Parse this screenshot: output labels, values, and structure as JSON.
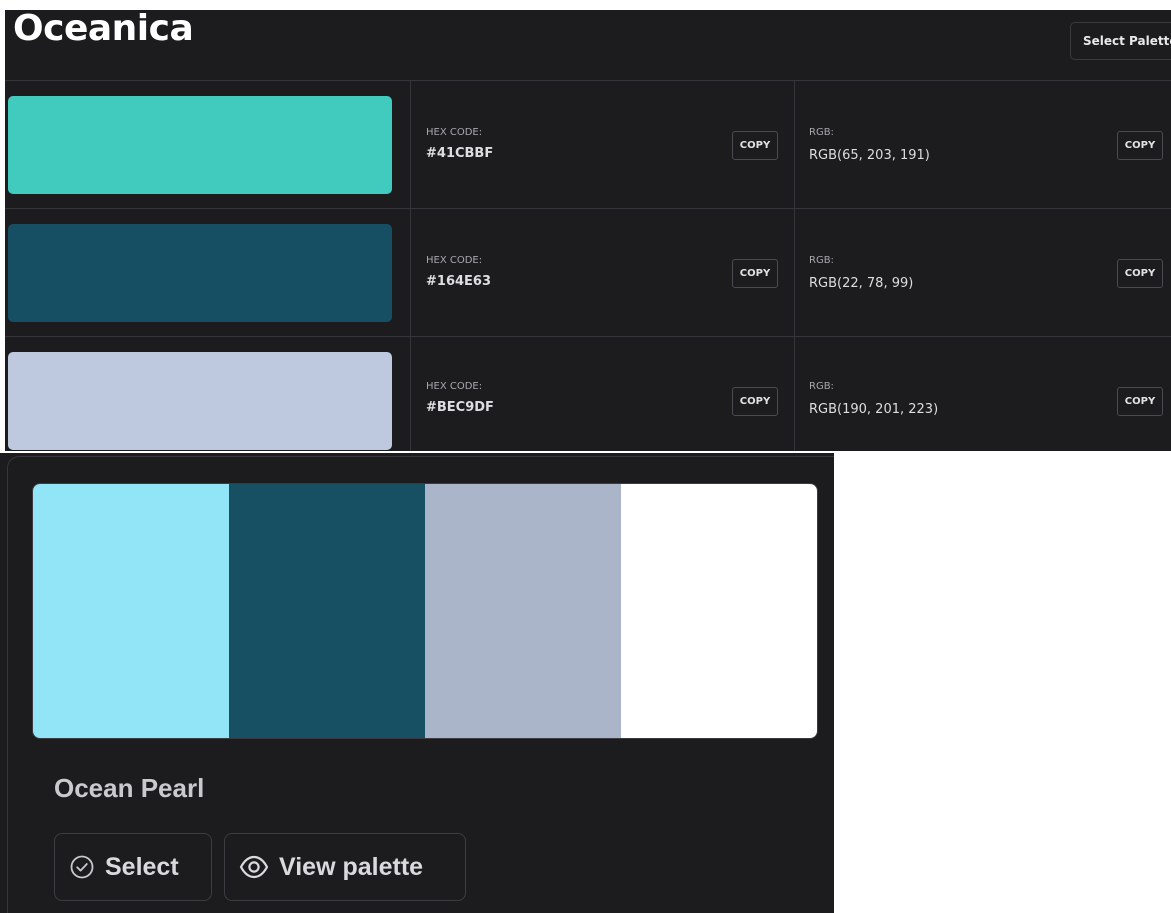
{
  "header": {
    "title": "Oceanica",
    "select_palette_label": "Select Palette"
  },
  "colors": [
    {
      "swatch": "#41CBBF",
      "hex_label": "HEX CODE:",
      "hex": "#41CBBF",
      "rgb_label": "RGB:",
      "rgb": "RGB(65, 203, 191)",
      "copy_label": "COPY"
    },
    {
      "swatch": "#164E63",
      "hex_label": "HEX CODE:",
      "hex": "#164E63",
      "rgb_label": "RGB:",
      "rgb": "RGB(22, 78, 99)",
      "copy_label": "COPY"
    },
    {
      "swatch": "#BEC9DF",
      "hex_label": "HEX CODE:",
      "hex": "#BEC9DF",
      "rgb_label": "RGB:",
      "rgb": "RGB(190, 201, 223)",
      "copy_label": "COPY"
    }
  ],
  "card": {
    "palette_colors": [
      "#91E5F6",
      "#174F63",
      "#ABB5C9",
      "#FFFFFF"
    ],
    "name": "Ocean Pearl",
    "select_label": "Select",
    "select_icon": "check-circle-icon",
    "view_label": "View palette",
    "view_icon": "eye-icon"
  },
  "theme": {
    "background": "#1C1C1F",
    "border": "#34343A",
    "text": "#DEDEE2"
  }
}
